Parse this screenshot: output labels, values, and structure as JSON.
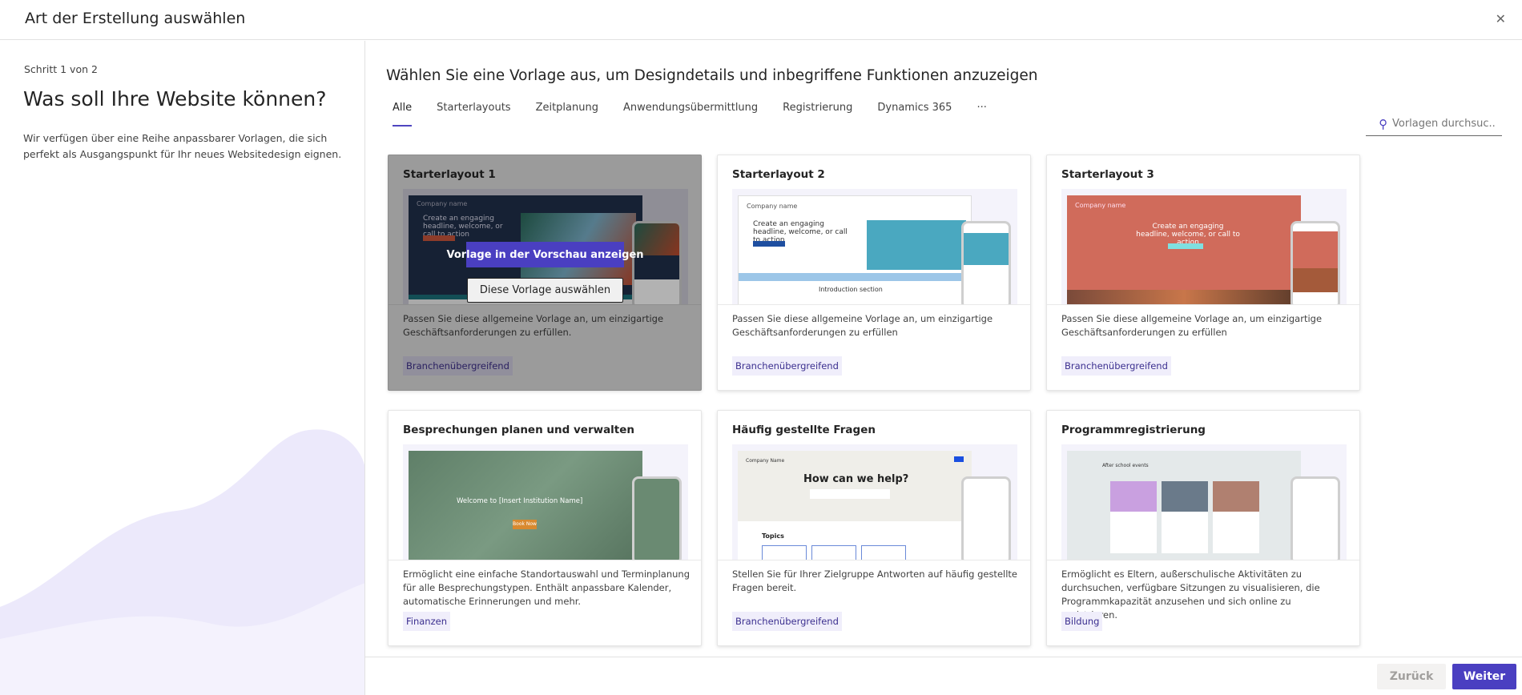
{
  "header": {
    "title": "Art der Erstellung auswählen",
    "close_icon": "close-icon"
  },
  "left": {
    "step": "Schritt 1 von 2",
    "heading": "Was soll Ihre Website können?",
    "description": "Wir verfügen über eine Reihe anpassbarer Vorlagen, die sich perfekt als Ausgangspunkt für Ihr neues Websitedesign eignen."
  },
  "main": {
    "heading": "Wählen Sie eine Vorlage aus, um Designdetails und inbegriffene Funktionen anzuzeigen",
    "tabs": [
      {
        "label": "Alle",
        "active": true
      },
      {
        "label": "Starterlayouts"
      },
      {
        "label": "Zeitplanung"
      },
      {
        "label": "Anwendungsübermittlung"
      },
      {
        "label": "Registrierung"
      },
      {
        "label": "Dynamics 365"
      },
      {
        "label": "···"
      }
    ],
    "search": {
      "placeholder": "Vorlagen durchsuc...",
      "icon": "search-icon"
    },
    "hover_actions": {
      "preview": "Vorlage in der Vorschau anzeigen",
      "select": "Diese Vorlage auswählen"
    },
    "cards": [
      {
        "title": "Starterlayout 1",
        "description": "Passen Sie diese allgemeine Vorlage an, um einzigartige Geschäftsanforderungen zu erfüllen.",
        "tag": "Branchenübergreifend",
        "preview": {
          "company": "Company name",
          "headline": "Create an engaging headline, welcome, or call to action",
          "color": "#1f2f4a"
        }
      },
      {
        "title": "Starterlayout 2",
        "description": "Passen Sie diese allgemeine Vorlage an, um einzigartige Geschäftsanforderungen zu erfüllen",
        "tag": "Branchenübergreifend",
        "preview": {
          "company": "Company name",
          "headline": "Create an engaging headline, welcome, or call to action",
          "section": "Introduction section",
          "color": "#ffffff"
        }
      },
      {
        "title": "Starterlayout 3",
        "description": "Passen Sie diese allgemeine Vorlage an, um einzigartige Geschäftsanforderungen zu erfüllen",
        "tag": "Branchenübergreifend",
        "preview": {
          "company": "Company name",
          "headline": "Create an engaging headline, welcome, or call to action",
          "color": "#d06b5b"
        }
      },
      {
        "title": "Besprechungen planen und verwalten",
        "description": "Ermöglicht eine einfache Standortauswahl und Terminplanung für alle Besprechungstypen. Enthält anpassbare Kalender, automatische Erinnerungen und mehr.",
        "tag": "Finanzen",
        "preview": {
          "headline": "Welcome to [Insert Institution Name]",
          "button": "Book Now",
          "color": "#6a8a72"
        }
      },
      {
        "title": "Häufig gestellte Fragen",
        "description": "Stellen Sie für Ihrer Zielgruppe Antworten auf häufig gestellte Fragen bereit.",
        "tag": "Branchenübergreifend",
        "preview": {
          "company": "Company Name",
          "headline": "How can we help?",
          "section": "Topics",
          "color": "#efeee9"
        }
      },
      {
        "title": "Programmregistrierung",
        "description": "Ermöglicht es Eltern, außerschulische Aktivitäten zu durchsuchen, verfügbare Sitzungen zu visualisieren, die Programmkapazität anzusehen und sich online zu registrieren.",
        "tag": "Bildung",
        "preview": {
          "headline": "After school events",
          "color": "#e4e9ea"
        }
      }
    ]
  },
  "footer": {
    "back": "Zurück",
    "next": "Weiter"
  },
  "colors": {
    "accent": "#4a3fc1",
    "tag_bg": "#f0eefb"
  }
}
